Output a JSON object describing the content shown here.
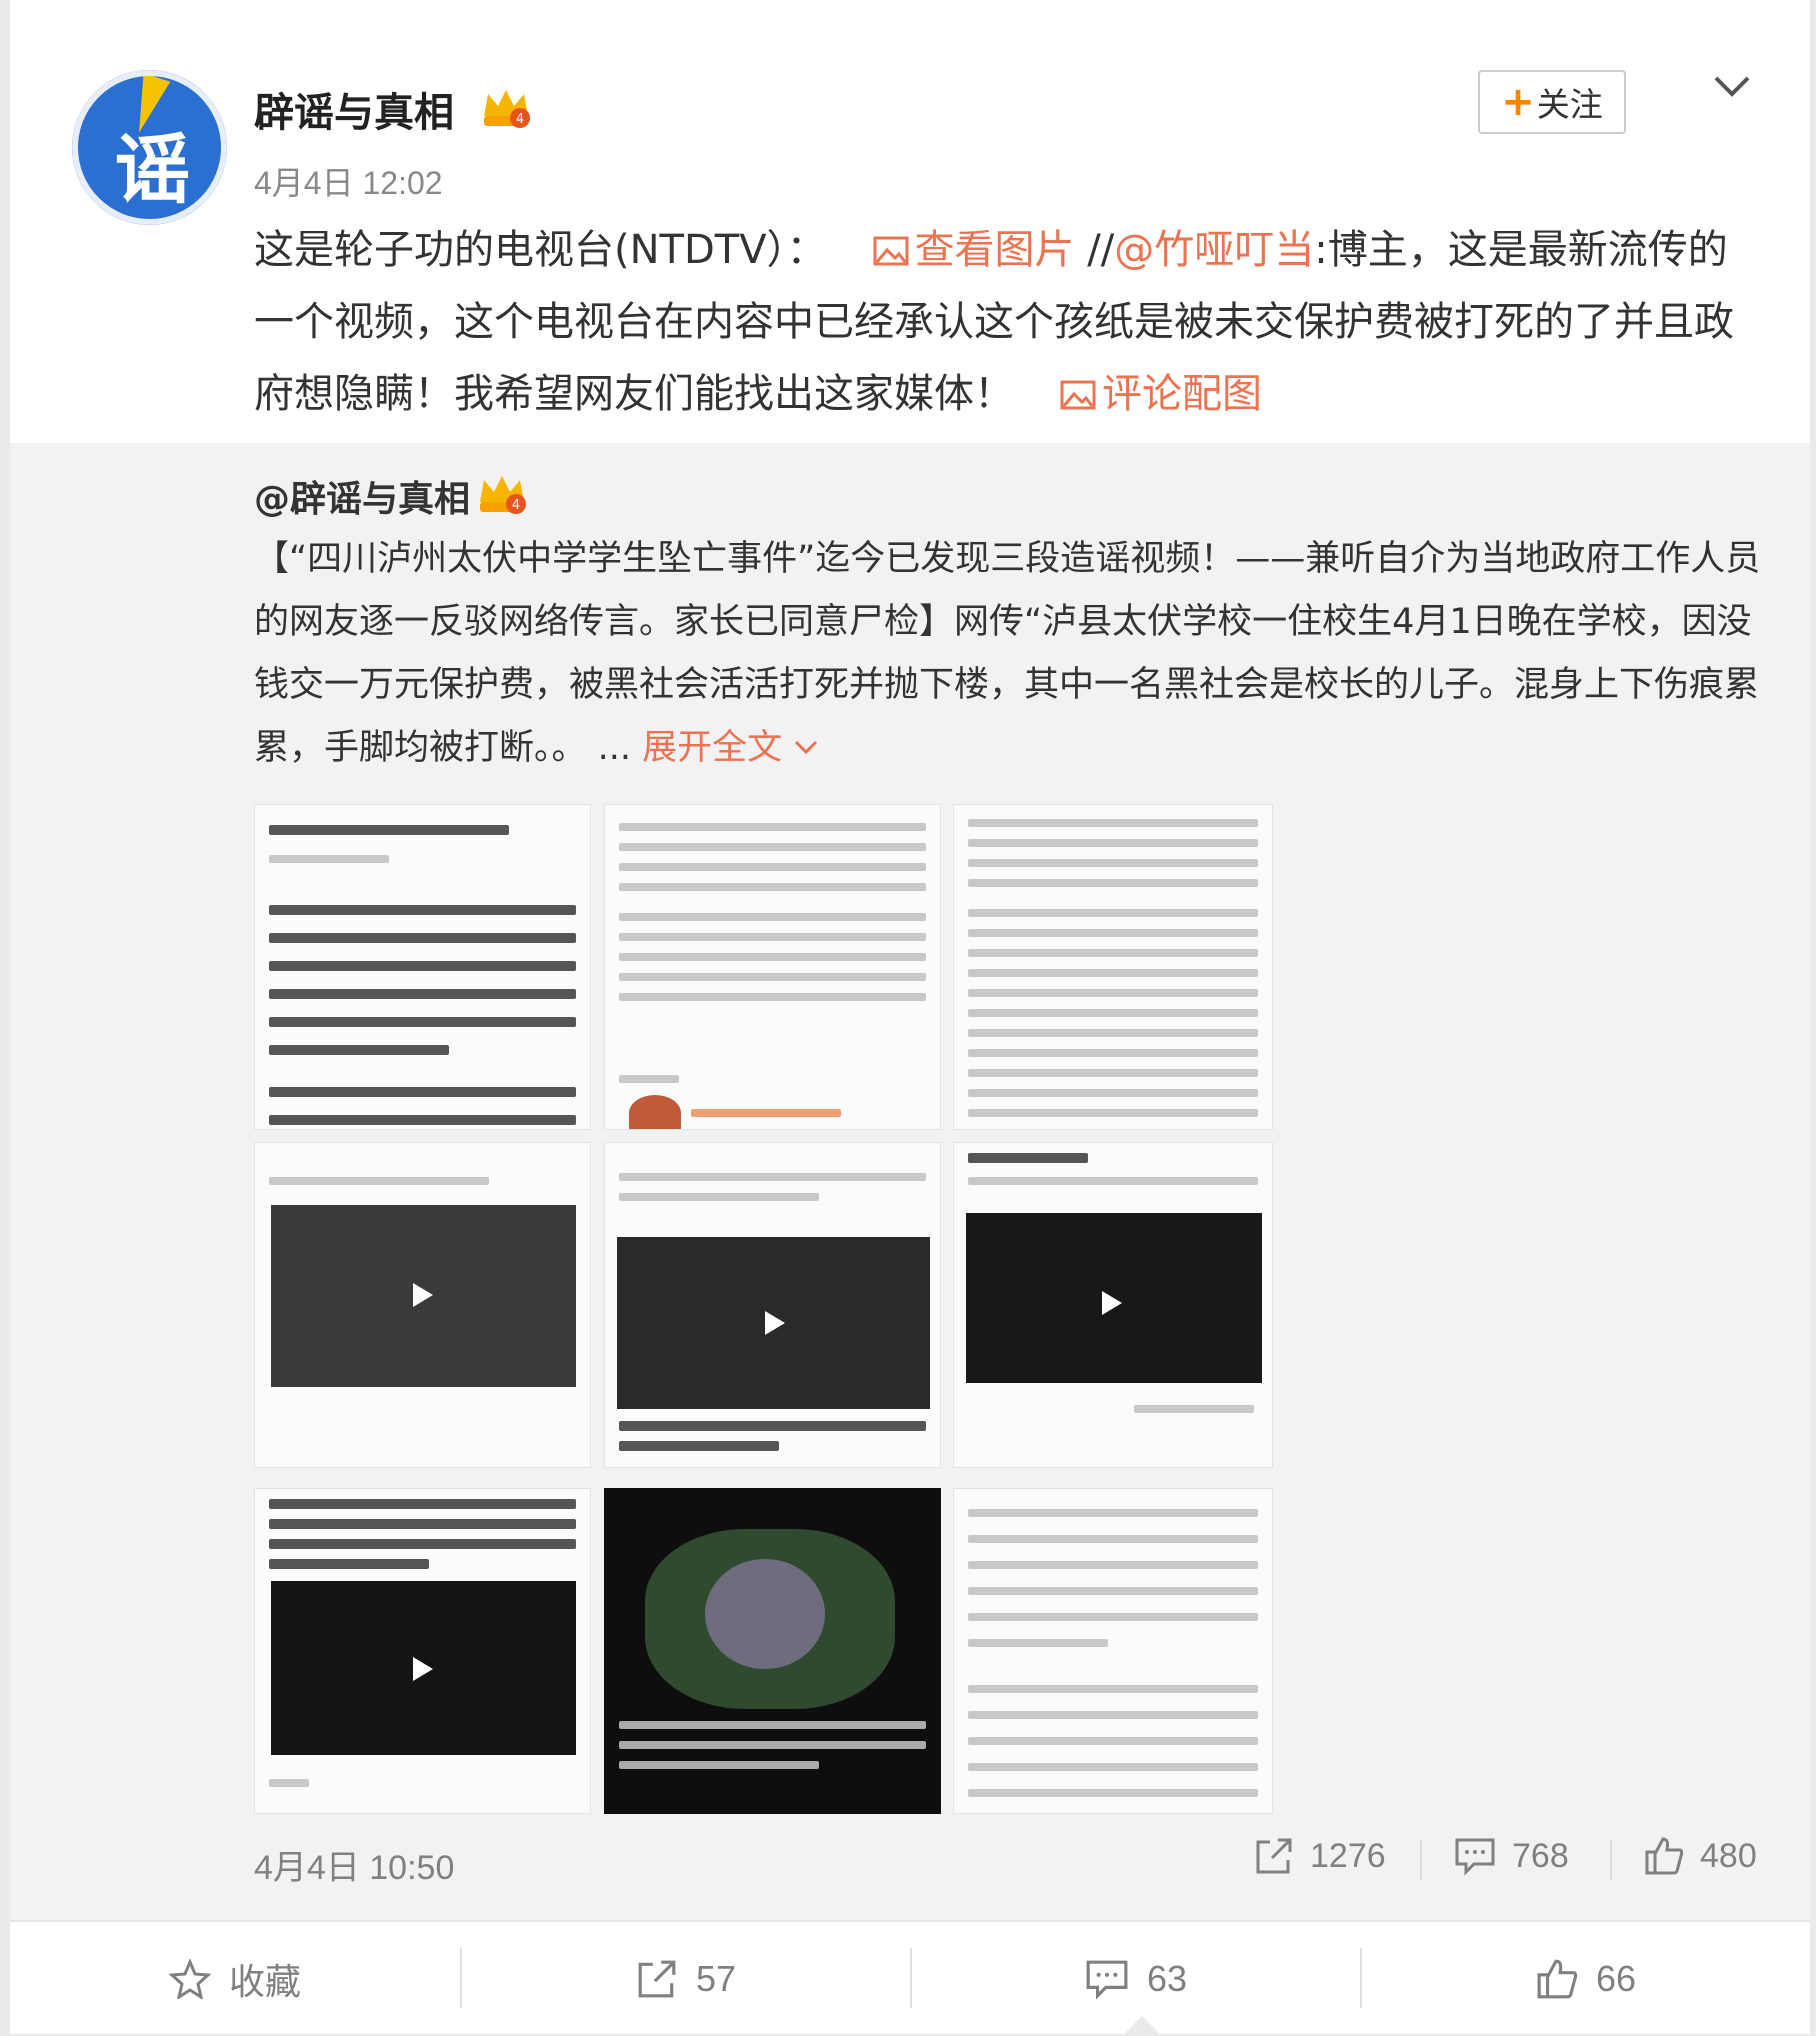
{
  "post": {
    "author": "辟谣与真相",
    "time": "4月4日 12:02",
    "follow_label": "关注",
    "text_before": "这是轮子功的电视台(NTDTV）：",
    "view_pic_label": "查看图片",
    "mention_prefix": " //",
    "mention": "@竹哑叮当",
    "text_after": ":博主，这是最新流传的一个视频，这个电视台在内容中已经承认这个孩纸是被未交保护费被打死的了并且政府想隐瞒！我希望网友们能找出这家媒体！",
    "comment_pic_label": "评论配图"
  },
  "repost": {
    "author": "@辟谣与真相",
    "text": "【“四川泸州太伏中学学生坠亡事件”迄今已发现三段造谣视频！——兼听自介为当地政府工作人员的网友逐一反驳网络传言。家长已同意尸检】网传“泸县太伏学校一住校生4月1日晚在学校，因没钱交一万元保护费，被黑社会活活打死并抛下楼，其中一名黑社会是校长的儿子。混身上下伤痕累累，手脚均被打断。。 ... ",
    "expand_label": "展开全文",
    "time": "4月4日 10:50",
    "reposts": "1276",
    "comments": "768",
    "likes": "480"
  },
  "bottom": {
    "favorite_label": "收藏",
    "reposts": "57",
    "comments": "63",
    "likes": "66"
  },
  "colors": {
    "link": "#eb7350",
    "accent": "#ff8200",
    "muted": "#808080"
  }
}
